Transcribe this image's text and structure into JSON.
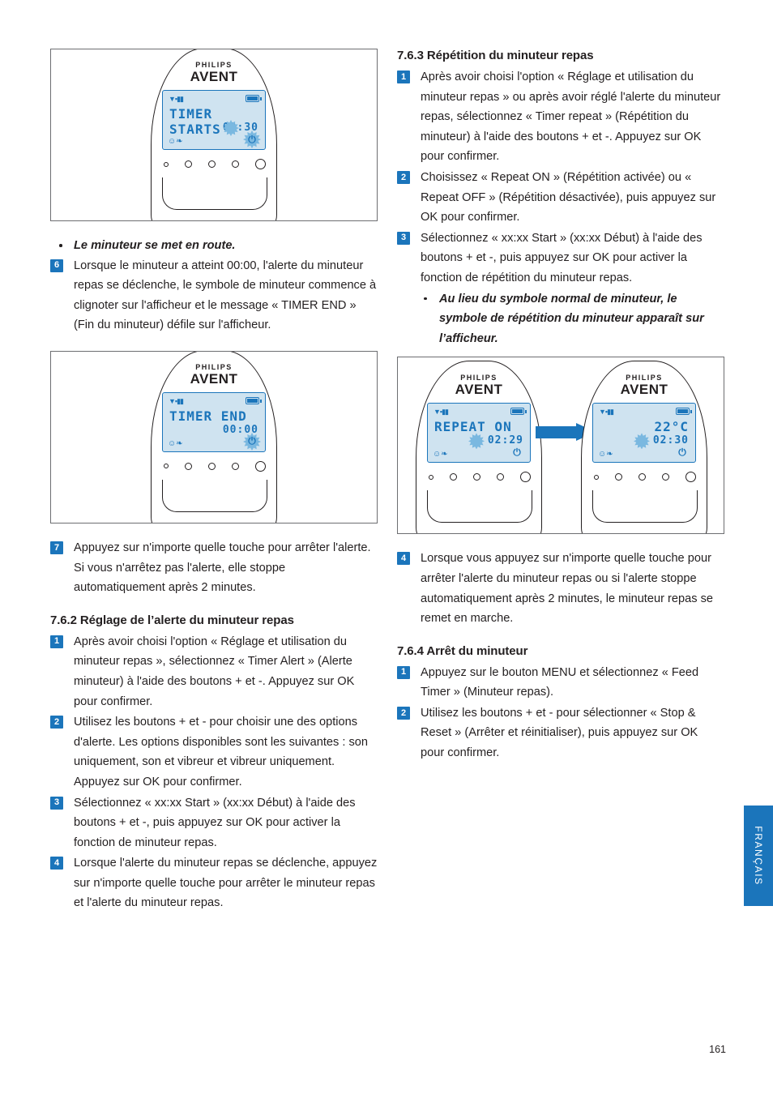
{
  "page": {
    "number": "161",
    "side_tab": "FRANÇAIS"
  },
  "brand": {
    "philips": "PHILIPS",
    "avent": "AVENT"
  },
  "devices": {
    "timer_starts": {
      "line1": "TIMER STARTS",
      "line2": "02:30",
      "power_icon": "⏻"
    },
    "timer_end": {
      "line1": "TIMER END",
      "line2": "00:00",
      "power_icon": "⏻"
    },
    "repeat_on": {
      "line1": "REPEAT ON",
      "line2": "02:29",
      "power_icon": "⏻"
    },
    "temp": {
      "line1": "22°C",
      "line2": "02:30",
      "power_icon": "⏻"
    }
  },
  "left_column": {
    "bullet1": "Le minuteur se met en route.",
    "step6": {
      "num": "6",
      "text": "Lorsque le minuteur a atteint 00:00, l'alerte du minuteur repas se déclenche, le symbole de minuteur commence à clignoter sur l'afficheur et le message « TIMER END » (Fin du minuteur) défile sur l'afficheur."
    },
    "step7": {
      "num": "7",
      "text": "Appuyez sur n'importe quelle touche pour arrêter l'alerte. Si vous n'arrêtez pas l'alerte, elle stoppe automatiquement après 2 minutes."
    },
    "section_762": {
      "heading": "7.6.2 Réglage de l’alerte du minuteur repas",
      "steps": [
        {
          "num": "1",
          "text": "Après avoir choisi l'option « Réglage et utilisation du minuteur repas », sélectionnez « Timer Alert » (Alerte minuteur) à l'aide des boutons + et -. Appuyez sur OK pour confirmer."
        },
        {
          "num": "2",
          "text": "Utilisez les boutons + et - pour choisir une des options d'alerte. Les options disponibles sont les suivantes : son uniquement, son et vibreur et vibreur uniquement. Appuyez sur OK pour confirmer."
        },
        {
          "num": "3",
          "text": "Sélectionnez « xx:xx Start » (xx:xx Début) à l'aide des boutons + et -, puis appuyez sur OK pour activer la fonction de minuteur repas."
        },
        {
          "num": "4",
          "text": "Lorsque l'alerte du minuteur repas se déclenche, appuyez sur n'importe quelle touche pour arrêter le minuteur repas et l'alerte du minuteur repas."
        }
      ]
    }
  },
  "right_column": {
    "section_763": {
      "heading": "7.6.3 Répétition du minuteur repas",
      "steps": [
        {
          "num": "1",
          "text": "Après avoir choisi l'option « Réglage et utilisation du minuteur repas » ou après avoir réglé l'alerte du minuteur repas, sélectionnez « Timer repeat » (Répétition du minuteur) à l'aide des boutons + et -. Appuyez sur OK pour confirmer."
        },
        {
          "num": "2",
          "text": "Choisissez « Repeat ON » (Répétition activée) ou « Repeat OFF » (Répétition désactivée), puis appuyez sur OK pour confirmer."
        },
        {
          "num": "3",
          "text": "Sélectionnez « xx:xx Start » (xx:xx Début) à l'aide des boutons + et -, puis appuyez sur OK pour activer la fonction de répétition du minuteur repas."
        }
      ],
      "bullet": "Au lieu du symbole normal de minuteur, le symbole de répétition du minuteur apparaît sur l’afficheur.",
      "step4": {
        "num": "4",
        "text": "Lorsque vous appuyez sur n'importe quelle touche pour arrêter l'alerte du minuteur repas ou si l'alerte stoppe automatiquement après 2 minutes, le minuteur repas se remet en marche."
      }
    },
    "section_764": {
      "heading": "7.6.4 Arrêt du minuteur",
      "steps": [
        {
          "num": "1",
          "text": "Appuyez sur le bouton MENU et sélectionnez « Feed Timer » (Minuteur repas)."
        },
        {
          "num": "2",
          "text": "Utilisez les boutons + et - pour sélectionner « Stop & Reset » (Arrêter et réinitialiser), puis appuyez sur OK pour confirmer."
        }
      ]
    }
  },
  "colors": {
    "accent": "#1b75bb",
    "screen_bg": "#cfe3f0",
    "text": "#231f20"
  }
}
